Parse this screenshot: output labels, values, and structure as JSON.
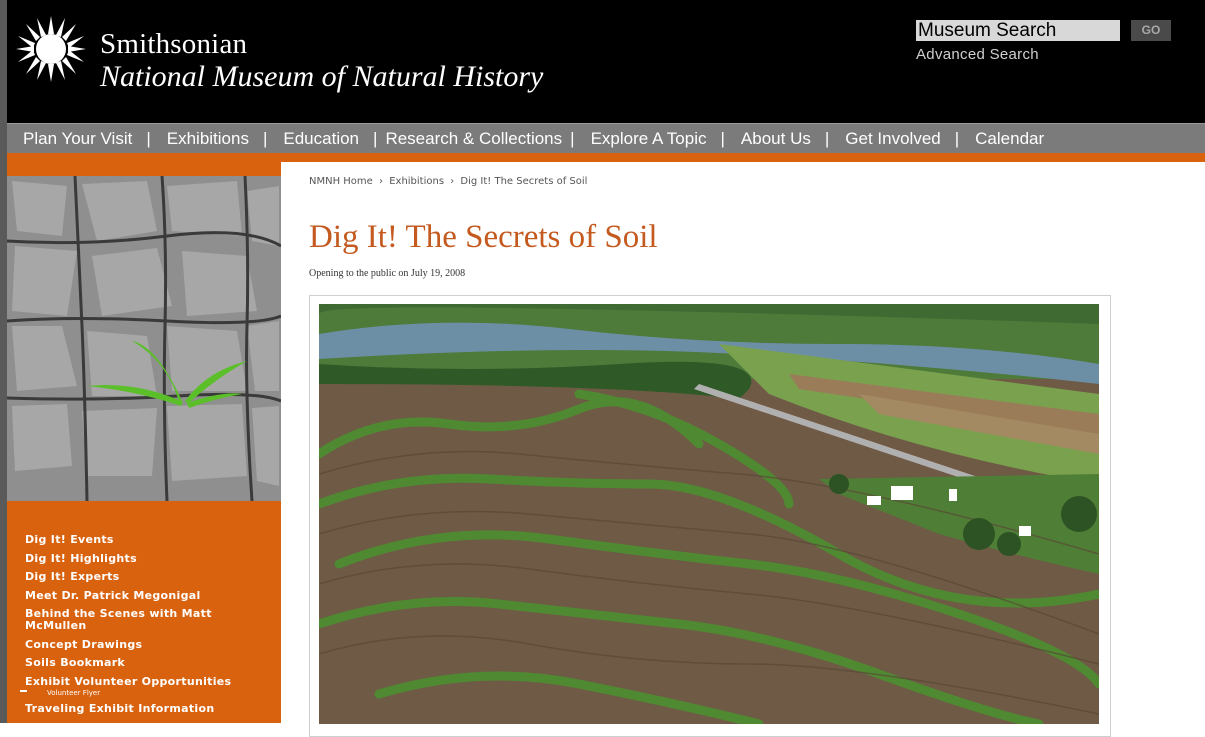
{
  "header": {
    "brand_line1": "Smithsonian",
    "brand_line2": "National Museum of Natural History",
    "search_placeholder": "Museum Search",
    "go_label": "GO",
    "advanced_search": "Advanced Search"
  },
  "nav": {
    "items": [
      {
        "label": "Plan Your Visit"
      },
      {
        "label": "Exhibitions"
      },
      {
        "label": "Education"
      },
      {
        "label": "Research & Collections"
      },
      {
        "label": "Explore A Topic"
      },
      {
        "label": "About Us"
      },
      {
        "label": "Get Involved"
      },
      {
        "label": "Calendar"
      }
    ],
    "separator": "|"
  },
  "breadcrumb": {
    "home": "NMNH Home",
    "section": "Exhibitions",
    "current": "Dig It! The Secrets of Soil",
    "sep": "›"
  },
  "page": {
    "title": "Dig It! The Secrets of Soil",
    "subtitle": "Opening to the public on July 19, 2008"
  },
  "sidebar": {
    "links": [
      "Dig It! Events",
      "Dig It! Highlights",
      "Dig It! Experts",
      "Meet Dr. Patrick Megonigal",
      "Behind the Scenes with Matt McMullen",
      "Concept Drawings",
      "Soils Bookmark",
      "Exhibit Volunteer Opportunities",
      "Volunteer Flyer",
      "Traveling Exhibit Information"
    ]
  },
  "colors": {
    "accent_orange": "#d9620f",
    "title_orange": "#c45a1f",
    "nav_gray": "#7b7b7b",
    "header_black": "#000000"
  }
}
